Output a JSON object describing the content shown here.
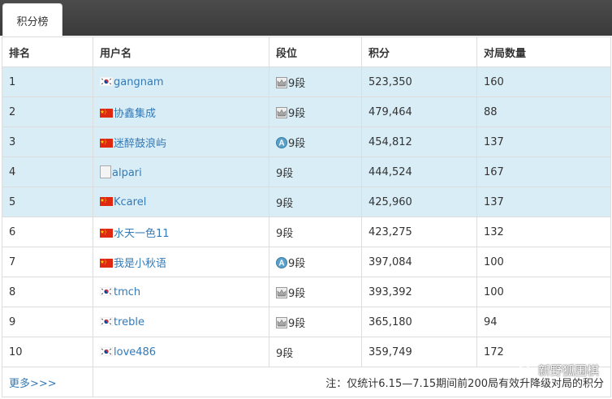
{
  "tab": {
    "label": "积分榜"
  },
  "headers": [
    "排名",
    "用户名",
    "段位",
    "积分",
    "对局数量"
  ],
  "rows": [
    {
      "rank": "1",
      "flag": "kr",
      "user": "gangnam",
      "dan_icon": "crown",
      "dan": "9段",
      "score": "523,350",
      "games": "160",
      "highlight": true
    },
    {
      "rank": "2",
      "flag": "cn",
      "user": "协鑫集成",
      "dan_icon": "crown",
      "dan": "9段",
      "score": "479,464",
      "games": "88",
      "highlight": true
    },
    {
      "rank": "3",
      "flag": "cn",
      "user": "迷醉鼓浪屿",
      "dan_icon": "amateur",
      "dan": "9段",
      "score": "454,812",
      "games": "137",
      "highlight": true
    },
    {
      "rank": "4",
      "flag": "broken",
      "user": "alpari",
      "dan_icon": "none",
      "dan": "9段",
      "score": "444,524",
      "games": "167",
      "highlight": true
    },
    {
      "rank": "5",
      "flag": "cn",
      "user": "Kcarel",
      "dan_icon": "none",
      "dan": "9段",
      "score": "425,960",
      "games": "137",
      "highlight": true
    },
    {
      "rank": "6",
      "flag": "cn",
      "user": "水天一色11",
      "dan_icon": "none",
      "dan": "9段",
      "score": "423,275",
      "games": "132",
      "highlight": false
    },
    {
      "rank": "7",
      "flag": "cn",
      "user": "我是小秋语",
      "dan_icon": "amateur",
      "dan": "9段",
      "score": "397,084",
      "games": "100",
      "highlight": false
    },
    {
      "rank": "8",
      "flag": "kr",
      "user": "tmch",
      "dan_icon": "crown",
      "dan": "9段",
      "score": "393,392",
      "games": "100",
      "highlight": false
    },
    {
      "rank": "9",
      "flag": "kr",
      "user": "treble",
      "dan_icon": "crown",
      "dan": "9段",
      "score": "365,180",
      "games": "94",
      "highlight": false
    },
    {
      "rank": "10",
      "flag": "kr",
      "user": "love486",
      "dan_icon": "none",
      "dan": "9段",
      "score": "359,749",
      "games": "172",
      "highlight": false
    }
  ],
  "footer": {
    "more": "更多>>>",
    "note": "注：仅统计6.15—7.15期间前200局有效升降级对局的积分"
  },
  "watermark": "新野狐围棋",
  "colors": {
    "highlight": "#d9edf7",
    "link": "#337ab7"
  }
}
